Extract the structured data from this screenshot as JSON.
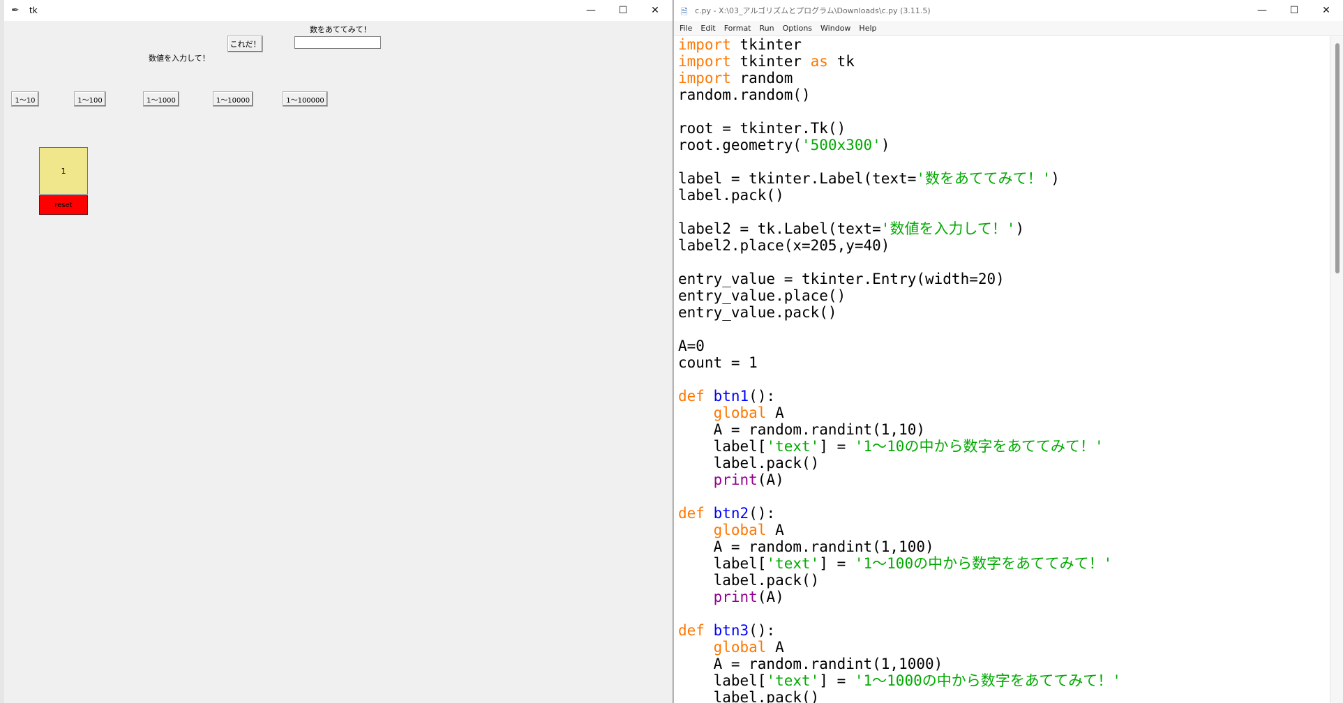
{
  "tk_window": {
    "title": "tk",
    "controls": [
      "—",
      "☐",
      "✕"
    ],
    "label_top": "数をあててみて！",
    "label_input": "数値を入力して！",
    "submit_button": "これだ！",
    "entry_value": "",
    "range_buttons": [
      "1〜10",
      "1〜100",
      "1〜1000",
      "1〜10000",
      "1〜100000"
    ],
    "count_label": "1",
    "reset_button": "reset",
    "colors": {
      "count_bg": "#f0e68c",
      "reset_bg": "#ff0000"
    }
  },
  "idle_window": {
    "title": "c.py - X:\\03_アルゴリズムとプログラム\\Downloads\\c.py (3.11.5)",
    "controls": [
      "—",
      "☐",
      "✕"
    ],
    "menu": [
      "File",
      "Edit",
      "Format",
      "Run",
      "Options",
      "Window",
      "Help"
    ],
    "code_lines": [
      [
        [
          "kw",
          "import"
        ],
        [
          "t",
          " tkinter"
        ]
      ],
      [
        [
          "kw",
          "import"
        ],
        [
          "t",
          " tkinter "
        ],
        [
          "kw",
          "as"
        ],
        [
          "t",
          " tk"
        ]
      ],
      [
        [
          "kw",
          "import"
        ],
        [
          "t",
          " random"
        ]
      ],
      [
        [
          "t",
          "random.random()"
        ]
      ],
      [
        [
          "t",
          ""
        ]
      ],
      [
        [
          "t",
          "root = tkinter.Tk()"
        ]
      ],
      [
        [
          "t",
          "root.geometry("
        ],
        [
          "str",
          "'500x300'"
        ],
        [
          "t",
          ")"
        ]
      ],
      [
        [
          "t",
          ""
        ]
      ],
      [
        [
          "t",
          "label = tkinter.Label(text="
        ],
        [
          "str",
          "'数をあててみて！'"
        ],
        [
          "t",
          ")"
        ]
      ],
      [
        [
          "t",
          "label.pack()"
        ]
      ],
      [
        [
          "t",
          ""
        ]
      ],
      [
        [
          "t",
          "label2 = tk.Label(text="
        ],
        [
          "str",
          "'数値を入力して！'"
        ],
        [
          "t",
          ")"
        ]
      ],
      [
        [
          "t",
          "label2.place(x=205,y=40)"
        ]
      ],
      [
        [
          "t",
          ""
        ]
      ],
      [
        [
          "t",
          "entry_value = tkinter.Entry(width=20)"
        ]
      ],
      [
        [
          "t",
          "entry_value.place()"
        ]
      ],
      [
        [
          "t",
          "entry_value.pack()"
        ]
      ],
      [
        [
          "t",
          ""
        ]
      ],
      [
        [
          "t",
          "A=0"
        ]
      ],
      [
        [
          "t",
          "count = 1"
        ]
      ],
      [
        [
          "t",
          ""
        ]
      ],
      [
        [
          "kw",
          "def"
        ],
        [
          "t",
          " "
        ],
        [
          "def",
          "btn1"
        ],
        [
          "t",
          "():"
        ]
      ],
      [
        [
          "t",
          "    "
        ],
        [
          "kw",
          "global"
        ],
        [
          "t",
          " A"
        ]
      ],
      [
        [
          "t",
          "    A = random.randint(1,10)"
        ]
      ],
      [
        [
          "t",
          "    label["
        ],
        [
          "str",
          "'text'"
        ],
        [
          "t",
          "] = "
        ],
        [
          "str",
          "'1〜10の中から数字をあててみて！'"
        ]
      ],
      [
        [
          "t",
          "    label.pack()"
        ]
      ],
      [
        [
          "t",
          "    "
        ],
        [
          "bi",
          "print"
        ],
        [
          "t",
          "(A)"
        ]
      ],
      [
        [
          "t",
          ""
        ]
      ],
      [
        [
          "kw",
          "def"
        ],
        [
          "t",
          " "
        ],
        [
          "def",
          "btn2"
        ],
        [
          "t",
          "():"
        ]
      ],
      [
        [
          "t",
          "    "
        ],
        [
          "kw",
          "global"
        ],
        [
          "t",
          " A"
        ]
      ],
      [
        [
          "t",
          "    A = random.randint(1,100)"
        ]
      ],
      [
        [
          "t",
          "    label["
        ],
        [
          "str",
          "'text'"
        ],
        [
          "t",
          "] = "
        ],
        [
          "str",
          "'1〜100の中から数字をあててみて！'"
        ]
      ],
      [
        [
          "t",
          "    label.pack()"
        ]
      ],
      [
        [
          "t",
          "    "
        ],
        [
          "bi",
          "print"
        ],
        [
          "t",
          "(A)"
        ]
      ],
      [
        [
          "t",
          ""
        ]
      ],
      [
        [
          "kw",
          "def"
        ],
        [
          "t",
          " "
        ],
        [
          "def",
          "btn3"
        ],
        [
          "t",
          "():"
        ]
      ],
      [
        [
          "t",
          "    "
        ],
        [
          "kw",
          "global"
        ],
        [
          "t",
          " A"
        ]
      ],
      [
        [
          "t",
          "    A = random.randint(1,1000)"
        ]
      ],
      [
        [
          "t",
          "    label["
        ],
        [
          "str",
          "'text'"
        ],
        [
          "t",
          "] = "
        ],
        [
          "str",
          "'1〜1000の中から数字をあててみて！'"
        ]
      ],
      [
        [
          "t",
          "    label.pack()"
        ]
      ]
    ],
    "syntax_colors": {
      "keyword": "#ff7700",
      "definition": "#0000ff",
      "string": "#00aa00",
      "builtin": "#900090"
    }
  }
}
